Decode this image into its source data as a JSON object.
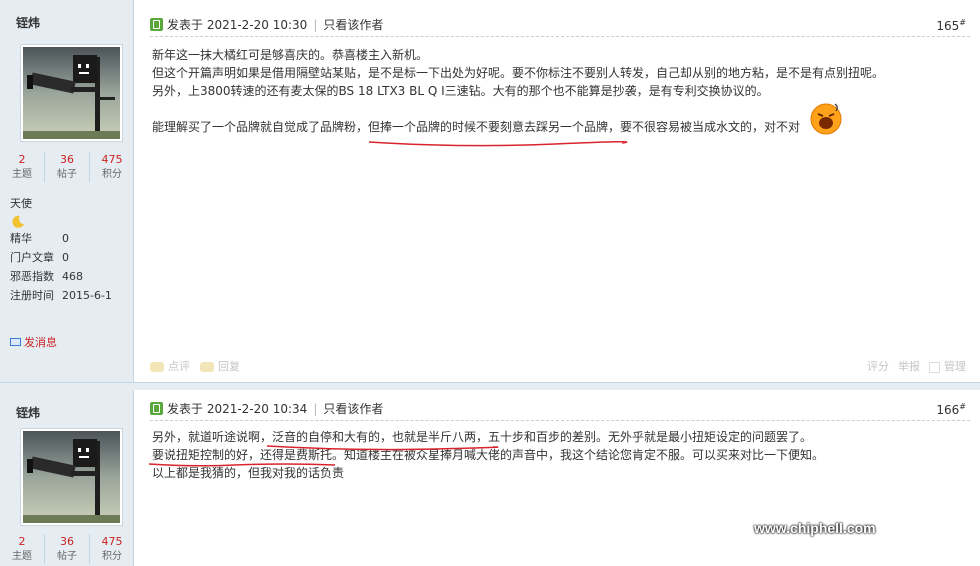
{
  "posts": [
    {
      "author": "铚炜",
      "stats": [
        {
          "num": "2",
          "label": "主题"
        },
        {
          "num": "36",
          "label": "帖子"
        },
        {
          "num": "475",
          "label": "积分"
        }
      ],
      "rank": "天使",
      "info": [
        {
          "key": "精华",
          "value": "0"
        },
        {
          "key": "门户文章",
          "value": "0"
        },
        {
          "key": "邪恶指数",
          "value": "468"
        },
        {
          "key": "注册时间",
          "value": "2015-6-1"
        }
      ],
      "send_message": "发消息",
      "posted_at": "发表于 2021-2-20 10:30",
      "only_author": "只看该作者",
      "floor": "165",
      "floor_mark": "#",
      "lines": [
        "新年这一抹大橘红可是够喜庆的。恭喜楼主入新机。",
        "但这个开篇声明如果是借用隔壁站某贴，是不是标一下出处为好呢。要不你标注不要别人转发，自己却从别的地方粘，是不是有点别扭呢。",
        "另外，上3800转速的还有麦太保的BS 18 LTX3 BL Q I三速钻。大有的那个也不能算是抄袭，是有专利交换协议的。"
      ],
      "line4_a": "能理解买了一个品牌就自觉成了品牌粉，",
      "line4_b": "但捧一个品牌的时候不要刻意去踩另一个品牌，",
      "line4_c": "要不很容易被当成水文的，对不对",
      "footer_left": [
        "点评",
        "回复"
      ],
      "footer_right": [
        "评分",
        "举报",
        "管理"
      ]
    },
    {
      "author": "铚炜",
      "stats": [
        {
          "num": "2",
          "label": "主题"
        },
        {
          "num": "36",
          "label": "帖子"
        },
        {
          "num": "475",
          "label": "积分"
        }
      ],
      "posted_at": "发表于 2021-2-20 10:34",
      "only_author": "只看该作者",
      "floor": "166",
      "floor_mark": "#",
      "l1_a": "另外，就道听途说啊，",
      "l1_b": "泛音的自停和大有的，也就是半斤八两，",
      "l1_c": "五十步和百步的差别。无外乎就是最小扭矩设定的问题罢了。",
      "l2_a": "要说扭矩控制的好，还得是费斯托。",
      "l2_b": "知道楼主在被众星捧月喊大佬的声音中，我这个结论您肯定不服。可以买来对比一下便知。",
      "l3": "以上都是我猜的，但我对我的话负责"
    }
  ],
  "watermark": "www.chiphell.com",
  "colors": {
    "accent_red": "#c22",
    "sidebar_bg": "#e5edf2",
    "underline": "#d9232d"
  }
}
